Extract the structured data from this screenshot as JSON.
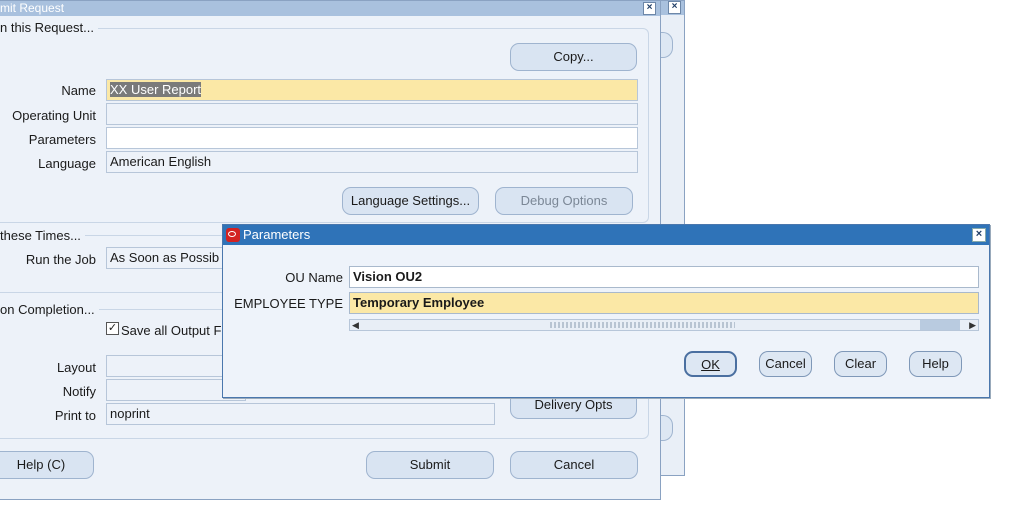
{
  "main_window": {
    "title": "mit Request",
    "request_section": "n this Request...",
    "copy_button": "Copy...",
    "fields": {
      "name_label": "Name",
      "name_value": "XX User Report",
      "operating_unit_label": "Operating Unit",
      "operating_unit_value": "",
      "parameters_label": "Parameters",
      "parameters_value": "",
      "language_label": "Language",
      "language_value": "American English"
    },
    "language_settings_button": "Language Settings...",
    "debug_options_button": "Debug Options",
    "times_section": "these Times...",
    "run_job_label": "Run the Job",
    "run_job_value": "As Soon as Possib",
    "completion_section": "on Completion...",
    "save_output_label": "Save all Output F",
    "save_output_checked": true,
    "layout_label": "Layout",
    "layout_value": "",
    "notify_label": "Notify",
    "notify_value": "",
    "print_to_label": "Print to",
    "print_to_value": "noprint",
    "delivery_opts_button": "Delivery Opts",
    "help_button": "Help (C)",
    "submit_button": "Submit",
    "cancel_button": "Cancel"
  },
  "parameters_dialog": {
    "title": "Parameters",
    "ou_name_label": "OU Name",
    "ou_name_value": "Vision OU2",
    "employee_type_label": "EMPLOYEE TYPE",
    "employee_type_value": "Temporary Employee",
    "ok_button": "OK",
    "cancel_button": "Cancel",
    "clear_button": "Clear",
    "help_button": "Help"
  }
}
